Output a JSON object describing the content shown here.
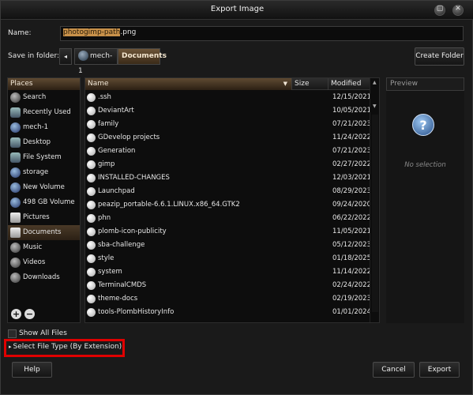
{
  "window": {
    "title": "Export Image"
  },
  "name_row": {
    "label": "Name:",
    "value_selected": "photogimp-path",
    "value_rest": ".png"
  },
  "folder_row": {
    "label": "Save in folder:",
    "nav_back": "◂",
    "crumbs": [
      "mech-1",
      "Documents"
    ],
    "create_folder": "Create Folder"
  },
  "places": {
    "header": "Places",
    "items": [
      {
        "label": "Search",
        "icon": "search-icon"
      },
      {
        "label": "Recently Used",
        "icon": "recent-icon"
      },
      {
        "label": "mech-1",
        "icon": "user-home-icon"
      },
      {
        "label": "Desktop",
        "icon": "desktop-icon"
      },
      {
        "label": "File System",
        "icon": "file-system-icon"
      },
      {
        "label": "storage",
        "icon": "drive-icon"
      },
      {
        "label": "New Volume",
        "icon": "drive-icon"
      },
      {
        "label": "498 GB Volume",
        "icon": "drive-icon"
      },
      {
        "label": "Pictures",
        "icon": "folder-icon"
      },
      {
        "label": "Documents",
        "icon": "folder-icon",
        "selected": true
      },
      {
        "label": "Music",
        "icon": "folder-icon"
      },
      {
        "label": "Videos",
        "icon": "folder-icon"
      },
      {
        "label": "Downloads",
        "icon": "folder-icon"
      }
    ],
    "add_symbol": "+",
    "remove_symbol": "−"
  },
  "files": {
    "columns": {
      "name": "Name",
      "size": "Size",
      "modified": "Modified"
    },
    "sort_indicator": "▼",
    "rows": [
      {
        "name": ".ssh",
        "modified": "12/15/2021"
      },
      {
        "name": "DeviantArt",
        "modified": "10/05/2021"
      },
      {
        "name": "family",
        "modified": "07/21/2023"
      },
      {
        "name": "GDevelop projects",
        "modified": "11/24/2022"
      },
      {
        "name": "Generation",
        "modified": "07/21/2023"
      },
      {
        "name": "gimp",
        "modified": "02/27/2022"
      },
      {
        "name": "INSTALLED-CHANGES",
        "modified": "12/03/2021"
      },
      {
        "name": "Launchpad",
        "modified": "08/29/2023"
      },
      {
        "name": "peazip_portable-6.6.1.LINUX.x86_64.GTK2",
        "modified": "09/24/2020"
      },
      {
        "name": "phn",
        "modified": "06/22/2022"
      },
      {
        "name": "plomb-icon-publicity",
        "modified": "11/05/2021"
      },
      {
        "name": "sba-challenge",
        "modified": "05/12/2023"
      },
      {
        "name": "style",
        "modified": "01/18/2025"
      },
      {
        "name": "system",
        "modified": "11/14/2022"
      },
      {
        "name": "TerminalCMDS",
        "modified": "02/24/2022"
      },
      {
        "name": "theme-docs",
        "modified": "02/19/2023"
      },
      {
        "name": "tools-PlombHistoryInfo",
        "modified": "01/01/2024"
      }
    ]
  },
  "preview": {
    "header": "Preview",
    "icon_glyph": "?",
    "empty_text": "No selection"
  },
  "options": {
    "show_all_files": "Show All Files",
    "file_type_arrow": "▸",
    "file_type": "Select File Type (By Extension)"
  },
  "buttons": {
    "help": "Help",
    "cancel": "Cancel",
    "export": "Export"
  }
}
